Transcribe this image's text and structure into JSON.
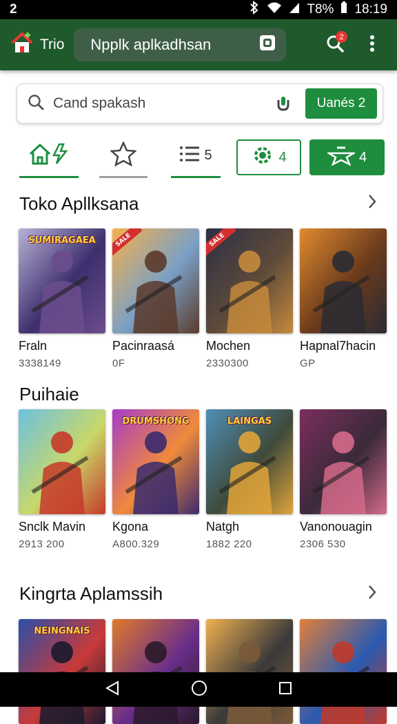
{
  "status": {
    "left_icon": "2",
    "battery": "T8%",
    "time": "18:19"
  },
  "appbar": {
    "home_label": "Trio",
    "pill_label": "Npplk aplkadhsan",
    "notif_count": "2"
  },
  "search": {
    "placeholder": "Cand spakash",
    "cta_label": "Uanés 2"
  },
  "tabs": [
    {
      "icon": "home-bolt-icon",
      "label": ""
    },
    {
      "icon": "star-icon",
      "label": ""
    },
    {
      "icon": "list-icon",
      "label": "5"
    },
    {
      "icon": "gear-icon",
      "label": "4"
    },
    {
      "icon": "plane-star-icon",
      "label": "4"
    }
  ],
  "sections": [
    {
      "title": "Toko Apllksana",
      "items": [
        {
          "name": "Fraln",
          "meta": "3338149",
          "art": "SUMIRAGAEA",
          "tag": "",
          "colors": [
            "#b9b2d6",
            "#3d2f6e",
            "#6c4d8c"
          ]
        },
        {
          "name": "Pacinraasá",
          "meta": "0F",
          "art": "",
          "tag": "SALE",
          "colors": [
            "#f6b04a",
            "#7aa0c6",
            "#5b3a2a"
          ]
        },
        {
          "name": "Mochen",
          "meta": "2330300",
          "art": "",
          "tag": "SALE",
          "colors": [
            "#2c2f44",
            "#5f4b3a",
            "#c48a3c"
          ]
        },
        {
          "name": "Hapnal7hacin",
          "meta": "GP",
          "art": "",
          "tag": "",
          "colors": [
            "#e08b2e",
            "#6a3a1c",
            "#2b2b33"
          ]
        }
      ]
    },
    {
      "title": "Puihaie",
      "items": [
        {
          "name": "Snclk Mavin",
          "meta": "2913 200",
          "art": "",
          "tag": "",
          "colors": [
            "#6cc1e0",
            "#c8d86a",
            "#c53a2a"
          ]
        },
        {
          "name": "Kgona",
          "meta": "A800.329",
          "art": "DRUMSHONG",
          "tag": "",
          "colors": [
            "#a63cc9",
            "#f08a3a",
            "#3a2a6e"
          ]
        },
        {
          "name": "Natgh",
          "meta": "1882 220",
          "art": "LAINGAS",
          "tag": "",
          "colors": [
            "#4f8fb8",
            "#3f4a3a",
            "#e0a43a"
          ]
        },
        {
          "name": "Vanonouagin",
          "meta": "2306 530",
          "art": "",
          "tag": "",
          "colors": [
            "#7b2e5c",
            "#3a2a3a",
            "#d46a8a"
          ]
        }
      ]
    },
    {
      "title": "Kingrta Aplamssih",
      "items": [
        {
          "name": "",
          "meta": "",
          "art": "NEINGNAIS",
          "tag": "",
          "colors": [
            "#2a4fa8",
            "#c83a3a",
            "#1a1a2e"
          ]
        },
        {
          "name": "",
          "meta": "",
          "art": "",
          "tag": "",
          "colors": [
            "#e07a2a",
            "#6a2e8a",
            "#2a1a2a"
          ]
        },
        {
          "name": "",
          "meta": "",
          "art": "",
          "tag": "",
          "colors": [
            "#f0b050",
            "#3a3a3a",
            "#7a5a3a"
          ]
        },
        {
          "name": "",
          "meta": "",
          "art": "",
          "tag": "",
          "colors": [
            "#e0803a",
            "#2a5ab0",
            "#c03a2a"
          ]
        }
      ]
    }
  ]
}
